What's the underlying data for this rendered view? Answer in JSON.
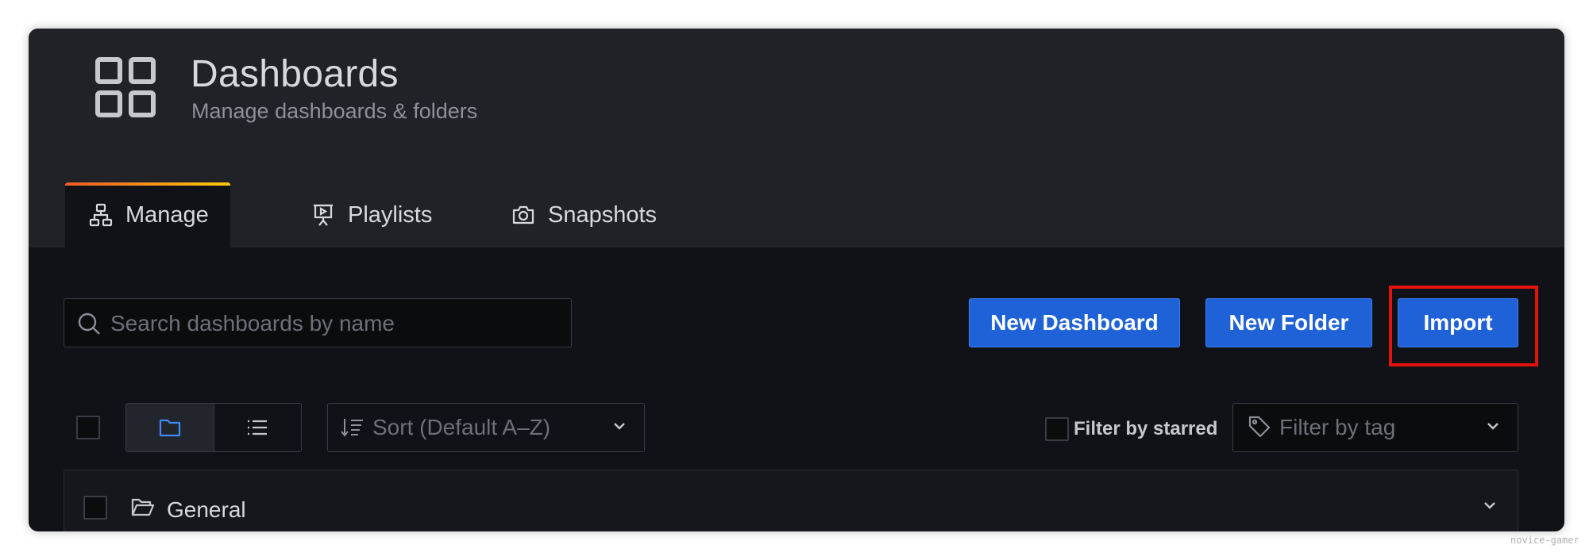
{
  "header": {
    "title": "Dashboards",
    "subtitle": "Manage dashboards & folders",
    "icon": "dashboard-grid-icon"
  },
  "tabs": [
    {
      "label": "Manage",
      "icon": "sitemap-icon",
      "active": true
    },
    {
      "label": "Playlists",
      "icon": "presentation-icon",
      "active": false
    },
    {
      "label": "Snapshots",
      "icon": "camera-icon",
      "active": false
    }
  ],
  "search": {
    "placeholder": "Search dashboards by name",
    "value": ""
  },
  "actions": {
    "new_dashboard": "New Dashboard",
    "new_folder": "New Folder",
    "import": "Import"
  },
  "toolbar": {
    "sort_label": "Sort (Default A–Z)",
    "filter_starred_label": "Filter by starred",
    "filter_tag_placeholder": "Filter by tag",
    "view_mode": "folders"
  },
  "folders": [
    {
      "name": "General",
      "icon": "folder-open-icon"
    }
  ],
  "watermark": "novice-gamer",
  "colors": {
    "background": "#111217",
    "header": "#202227",
    "primary_button": "#1f62d8",
    "active_view_icon": "#3d8bfd",
    "highlight": "#e3120b"
  }
}
